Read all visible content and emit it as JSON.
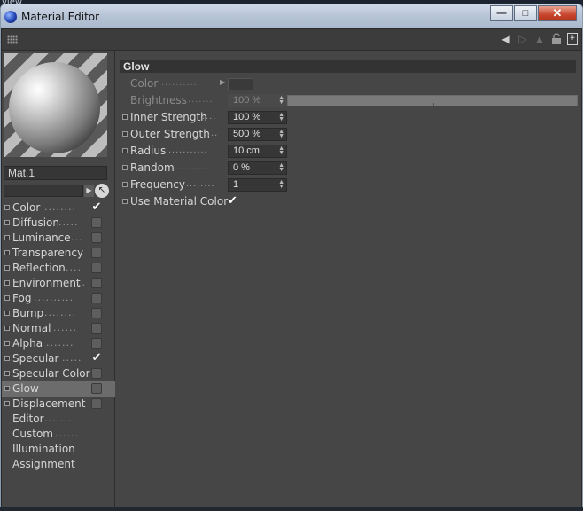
{
  "desktop_label": "view",
  "window": {
    "title": "Material Editor",
    "minimize": "—",
    "maximize": "□",
    "close": "✕"
  },
  "toolbar": {
    "icons": [
      "back-arrow-icon",
      "forward-arrow-icon",
      "up-arrow-icon",
      "lock-icon",
      "new-window-icon"
    ]
  },
  "material": {
    "name": "Mat.1"
  },
  "channels": [
    {
      "label": "Color",
      "dots": "........",
      "checked": true,
      "check_glyph": "✔"
    },
    {
      "label": "Diffusion",
      "dots": ".....",
      "checked": false
    },
    {
      "label": "Luminance",
      "dots": "...",
      "checked": false
    },
    {
      "label": "Transparency",
      "dots": "",
      "checked": false
    },
    {
      "label": "Reflection",
      "dots": "....",
      "checked": false
    },
    {
      "label": "Environment",
      "dots": "..",
      "checked": false
    },
    {
      "label": "Fog",
      "dots": "..........",
      "checked": false
    },
    {
      "label": "Bump",
      "dots": "........",
      "checked": false
    },
    {
      "label": "Normal",
      "dots": "......",
      "checked": false
    },
    {
      "label": "Alpha",
      "dots": ".......",
      "checked": false
    },
    {
      "label": "Specular",
      "dots": ".....",
      "checked": true,
      "check_glyph": "✔"
    },
    {
      "label": "Specular Color",
      "dots": "",
      "checked": false
    },
    {
      "label": "Glow",
      "dots": "",
      "checked": false,
      "active": true
    },
    {
      "label": "Displacement",
      "dots": "",
      "checked": false
    },
    {
      "label": "Editor",
      "dots": "........",
      "no_toggle": true
    },
    {
      "label": "Custom",
      "dots": "......",
      "no_toggle": true
    },
    {
      "label": "Illumination",
      "dots": "",
      "no_toggle": true
    },
    {
      "label": "Assignment",
      "dots": "",
      "no_toggle": true
    }
  ],
  "glow": {
    "heading": "Glow",
    "color": {
      "label": "Color",
      "dots": ".........."
    },
    "brightness": {
      "label": "Brightness",
      "dots": "........",
      "value": "100 %",
      "spin_up": "▲",
      "spin_down": "▼"
    },
    "inner_strength": {
      "label": "Inner Strength",
      "dots": "....",
      "value": "100 %",
      "spin_up": "▲",
      "spin_down": "▼"
    },
    "outer_strength": {
      "label": "Outer Strength",
      "dots": "....",
      "value": "500 %",
      "spin_up": "▲",
      "spin_down": "▼"
    },
    "radius": {
      "label": "Radius",
      "dots": "...........",
      "value": "10 cm",
      "spin_up": "▲",
      "spin_down": "▼"
    },
    "random": {
      "label": "Random",
      "dots": "..........",
      "value": "0 %",
      "spin_up": "▲",
      "spin_down": "▼"
    },
    "frequency": {
      "label": "Frequency",
      "dots": "........",
      "value": "1",
      "spin_up": "▲",
      "spin_down": "▼"
    },
    "use_material_color": {
      "label": "Use Material Color",
      "checked": true,
      "check_glyph": "✔"
    }
  }
}
